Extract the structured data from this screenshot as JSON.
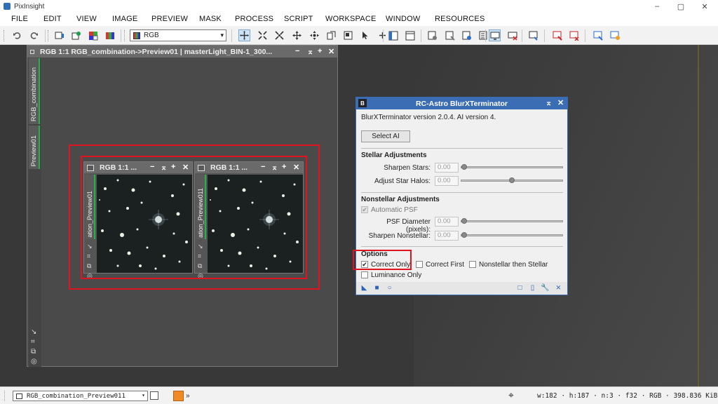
{
  "app": {
    "title": "PixInsight"
  },
  "window_controls": {
    "minimize": "–",
    "maximize": "▢",
    "close": "✕"
  },
  "menu": [
    "FILE",
    "EDIT",
    "VIEW",
    "IMAGE",
    "PREVIEW",
    "MASK",
    "PROCESS",
    "SCRIPT",
    "WORKSPACE",
    "WINDOW",
    "RESOURCES"
  ],
  "toolbar": {
    "channel_select": "RGB",
    "channel_arrow": "▾"
  },
  "image_window": {
    "title": "RGB 1:1 RGB_combination->Preview01 | masterLight_BIN-1_300...",
    "controls": [
      "−",
      "⌅",
      "+",
      "✕"
    ],
    "tabs": [
      "RGB_combination",
      "Preview01"
    ],
    "side_icons": [
      "↘",
      "⌗",
      "⧉",
      "◎"
    ]
  },
  "previews": [
    {
      "title": "RGB 1:1 ...",
      "tab": "ation_Preview01",
      "controls": [
        "−",
        "⌅",
        "+",
        "✕"
      ],
      "icons": [
        "↘",
        "⌗",
        "⧉",
        "◎"
      ]
    },
    {
      "title": "RGB 1:1 ...",
      "tab": "ation_Preview011",
      "controls": [
        "−",
        "⌅",
        "+",
        "✕"
      ],
      "icons": [
        "↘",
        "⌗",
        "⧉",
        "◎"
      ]
    }
  ],
  "blurx": {
    "title": "RC-Astro BlurXTerminator",
    "icon": "B",
    "title_controls": [
      "⌅",
      "✕"
    ],
    "version": "BlurXTerminator version 2.0.4. AI version 4.",
    "select_ai": "Select AI",
    "stellar": {
      "heading": "Stellar Adjustments",
      "sharpen_stars": {
        "label": "Sharpen Stars:",
        "value": "0.00",
        "level": 0.0
      },
      "adjust_halos": {
        "label": "Adjust Star Halos:",
        "value": "0.00",
        "level": 0.5
      }
    },
    "nonstellar": {
      "heading": "Nonstellar Adjustments",
      "auto_psf": {
        "label": "Automatic PSF",
        "checked": true,
        "mark": "✔"
      },
      "psf_diameter": {
        "label": "PSF Diameter (pixels):",
        "value": "0.00",
        "level": 0.0
      },
      "sharpen_nonstellar": {
        "label": "Sharpen Nonstellar:",
        "value": "0.00",
        "level": 0.0
      }
    },
    "options": {
      "heading": "Options",
      "correct_only": {
        "label": "Correct Only",
        "checked": true,
        "mark": "✔"
      },
      "correct_first": {
        "label": "Correct First",
        "checked": false
      },
      "nonstellar_then_stellar": {
        "label": "Nonstellar then Stellar",
        "checked": false
      },
      "luminance_only": {
        "label": "Luminance Only",
        "checked": false
      }
    },
    "footer_icons": {
      "new_instance": "◣",
      "apply_global": "■",
      "real_time": "○",
      "reset": "□",
      "doc": "▯",
      "settings": "🔧",
      "cross": "⨯"
    }
  },
  "status": {
    "view": "RGB_combination_Preview011",
    "more": "»",
    "info": "w:182 · h:187 · n:3 · f32 · RGB · 398.836 KiB"
  }
}
